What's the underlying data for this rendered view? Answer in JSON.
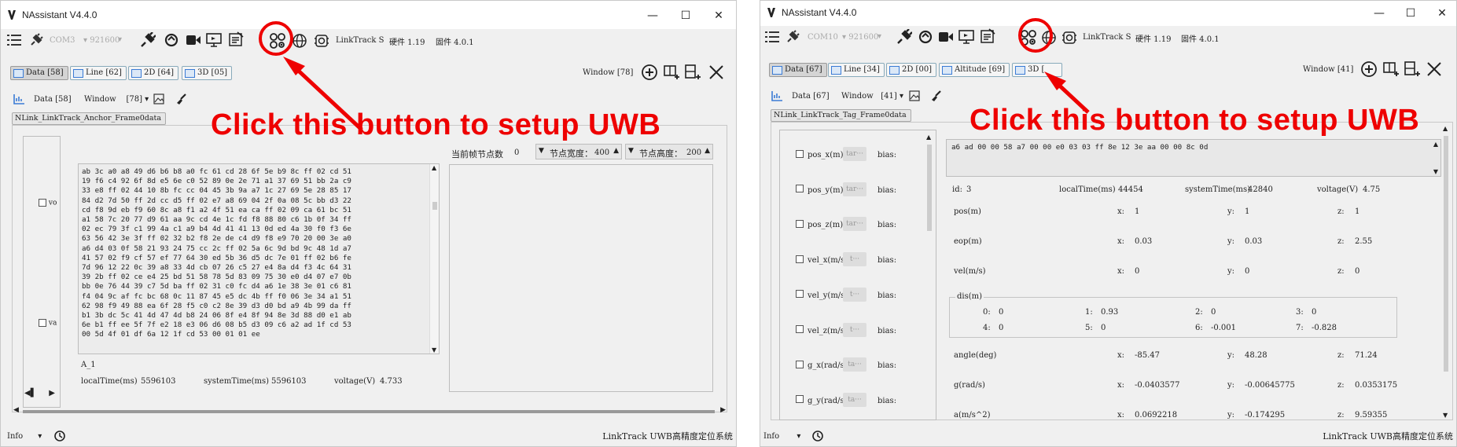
{
  "app_title": "NAssistant V4.4.0",
  "window_controls": {
    "min": "—",
    "max": "☐",
    "close": "✕"
  },
  "annotation_text": "Click this button to setup UWB",
  "left": {
    "toolbar": {
      "com": "COM3",
      "baud": "921600",
      "device": "LinkTrack S",
      "hardware": "硬件 1.19",
      "firmware": "固件 4.0.1"
    },
    "tabs": [
      {
        "label": "Data [58]",
        "active": true
      },
      {
        "label": "Line [62]",
        "active": false
      },
      {
        "label": "2D [64]",
        "active": false
      },
      {
        "label": "3D [05]",
        "active": false
      }
    ],
    "window_label": "Window  [78]",
    "subtoolbar": {
      "data_label": "Data [58]",
      "window_label": "Window",
      "window_value": "[78]"
    },
    "frame_tab": "NLink_LinkTrack_Anchor_Frame0data",
    "check_vo": "vo",
    "check_va": "va",
    "hex_text": "ab 3c a0 a8 49 d6 b6 b8 a0 fc 61 cd 28 6f 5e b9 8c ff 02 cd 51\n19 f6 c4 92 6f 8d e5 6e c0 52 89 0e 2e 71 a1 37 69 51 bb 2a c9\n33 e8 ff 02 44 10 8b fc cc 04 45 3b 9a a7 1c 27 69 5e 28 85 17\n84 d2 7d 50 ff 2d cc d5 ff 02 e7 a8 69 04 2f 0a 08 5c bb d3 22\ncd f8 9d eb f9 60 8c a8 f1 a2 4f 51 ea ca ff 02 09 ca 61 bc 51\na1 58 7c 20 77 d9 61 aa 9c cd 4e 1c fd f8 88 80 c6 1b 0f 34 ff\n02 ec 79 3f c1 99 4a c1 a9 b4 4d 41 41 13 0d ed 4a 30 f0 f3 6e\n63 56 42 3e 3f ff 02 32 b2 f8 2e de c4 d9 f8 e9 70 20 00 3e a0\na6 d4 03 0f 58 21 93 24 75 cc 2c ff 02 5a 6c 9d bd 9c 48 1d a7\n41 57 02 f9 cf 57 ef 77 64 30 ed 5b 36 d5 dc 7e 01 ff 02 b6 fe\n7d 96 12 22 0c 39 a8 33 4d cb 07 26 c5 27 e4 8a d4 f3 4c 64 31\n39 2b ff 02 ce e4 25 bd 51 58 78 5d 83 09 75 30 e0 d4 07 e7 0b\nbb 0e 76 44 39 c7 5d ba ff 02 31 c0 fc d4 a6 1e 38 3e 01 c6 81\nf4 04 9c af fc bc 68 0c 11 87 45 e5 dc 4b ff f0 06 3e 34 a1 51\n62 98 f9 49 88 ea 6f 28 f5 c0 c2 8e 39 d3 d0 bd a9 4b 99 da ff\nb1 3b dc 5c 41 4d 47 4d b8 24 06 8f e4 8f 94 8e 3d 88 d0 e1 ab\n6e b1 ff ee 5f 7f e2 18 e3 06 d6 08 b5 d3 09 c6 a2 ad 1f cd 53\n00 5d 4f 01 df 6a 12 1f cd 53 00 01 01 ee",
    "node_count_label": "当前帧节点数",
    "node_count": "0",
    "node_width_label": "节点宽度：",
    "node_width": "400",
    "node_height_label": "节点高度：",
    "node_height": "200",
    "anchor_id": "A_1",
    "localtime_label": "localTime(ms)",
    "localtime": "5596103",
    "systime_label": "systemTime(ms)",
    "systime": "5596103",
    "voltage_label": "voltage(V)",
    "voltage": "4.733",
    "status_left": "Info",
    "status_right": "LinkTrack UWB高精度定位系统"
  },
  "right": {
    "toolbar": {
      "com": "COM10",
      "baud": "921600",
      "device": "LinkTrack S",
      "hardware": "硬件 1.19",
      "firmware": "固件 4.0.1"
    },
    "tabs": [
      {
        "label": "Data [67]",
        "active": true
      },
      {
        "label": "Line [34]",
        "active": false
      },
      {
        "label": "2D [00]",
        "active": false
      },
      {
        "label": "Altitude [69]",
        "active": false
      },
      {
        "label": "3D [",
        "active": false
      }
    ],
    "window_label": "Window  [41]",
    "subtoolbar": {
      "data_label": "Data [67]",
      "window_label": "Window",
      "window_value": "[41]"
    },
    "frame_tab": "NLink_LinkTrack_Tag_Frame0data",
    "plot_items": [
      {
        "label": "pos_x(m)",
        "chip": "tar···",
        "bias": "bias:"
      },
      {
        "label": "pos_y(m)",
        "chip": "tar···",
        "bias": "bias:"
      },
      {
        "label": "pos_z(m)",
        "chip": "tar···",
        "bias": "bias:"
      },
      {
        "label": "vel_x(m/s)",
        "chip": "t···",
        "bias": "bias:"
      },
      {
        "label": "vel_y(m/s)",
        "chip": "t···",
        "bias": "bias:"
      },
      {
        "label": "vel_z(m/s)",
        "chip": "t···",
        "bias": "bias:"
      },
      {
        "label": "g_x(rad/s)",
        "chip": "ta···",
        "bias": "bias:"
      },
      {
        "label": "g_y(rad/s)",
        "chip": "ta···",
        "bias": "bias:"
      }
    ],
    "hex_text": "a6 ad 00 00 58 a7 00 00 e0 03 03 ff 8e 12 3e aa 00 00 8c 0d",
    "header": {
      "id_label": "id:",
      "id": "3",
      "localtime_label": "localTime(ms)",
      "localtime": "44454",
      "systime_label": "systemTime(ms)",
      "systime": "42840",
      "voltage_label": "voltage(V)",
      "voltage": "4.75"
    },
    "rows": [
      {
        "name": "pos(m)",
        "x": "1",
        "y": "1",
        "z": "1"
      },
      {
        "name": "eop(m)",
        "x": "0.03",
        "y": "0.03",
        "z": "2.55"
      },
      {
        "name": "vel(m/s)",
        "x": "0",
        "y": "0",
        "z": "0"
      }
    ],
    "dis_label": "dis(m)",
    "dis": [
      {
        "k": "0:",
        "v": "0"
      },
      {
        "k": "1:",
        "v": "0.93"
      },
      {
        "k": "2:",
        "v": "0"
      },
      {
        "k": "3:",
        "v": "0"
      },
      {
        "k": "4:",
        "v": "0"
      },
      {
        "k": "5:",
        "v": "0"
      },
      {
        "k": "6:",
        "v": "-0.001"
      },
      {
        "k": "7:",
        "v": "-0.828"
      }
    ],
    "rows2": [
      {
        "name": "angle(deg)",
        "x": "-85.47",
        "y": "48.28",
        "z": "71.24"
      },
      {
        "name": "g(rad/s)",
        "x": "-0.0403577",
        "y": "-0.00645775",
        "z": "0.0353175"
      },
      {
        "name": "a(m/s^2)",
        "x": "0.0692218",
        "y": "-0.174295",
        "z": "9.59355"
      }
    ],
    "axis_labels": {
      "x": "x:",
      "y": "y:",
      "z": "z:"
    },
    "status_left": "Info",
    "status_right": "LinkTrack UWB高精度定位系统"
  }
}
